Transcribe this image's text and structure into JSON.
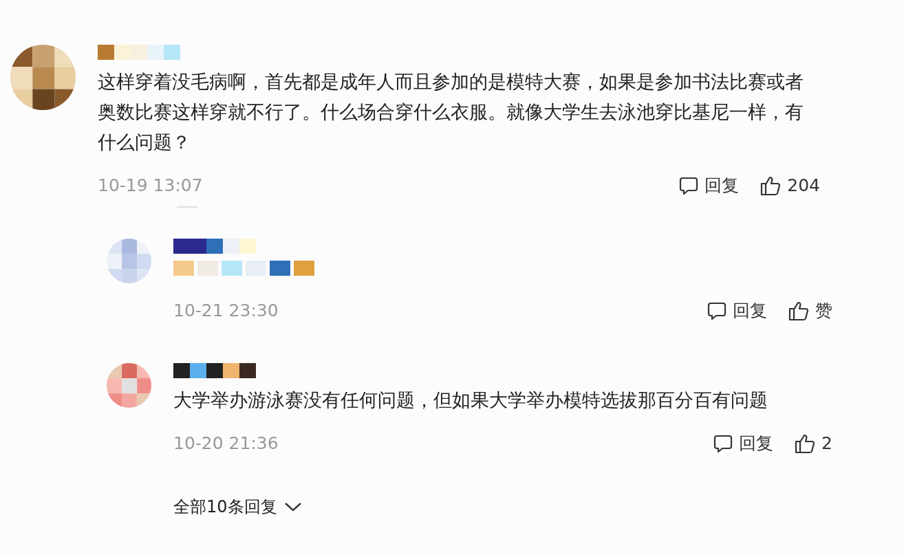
{
  "comment": {
    "text": "这样穿着没毛病啊，首先都是成年人而且参加的是模特大赛，如果是参加书法比赛或者奥数比赛这样穿就不行了。什么场合穿什么衣服。就像大学生去泳池穿比基尼一样，有什么问题？",
    "time": "10-19 13:07",
    "reply_label": "回复",
    "like_label": "204"
  },
  "replies": [
    {
      "time": "10-21 23:30",
      "reply_label": "回复",
      "like_label": "赞"
    },
    {
      "text": "大学举办游泳赛没有任何问题，但如果大学举办模特选拔那百分百有问题",
      "time": "10-20 21:36",
      "reply_label": "回复",
      "like_label": "2"
    }
  ],
  "more_replies": "全部10条回复"
}
